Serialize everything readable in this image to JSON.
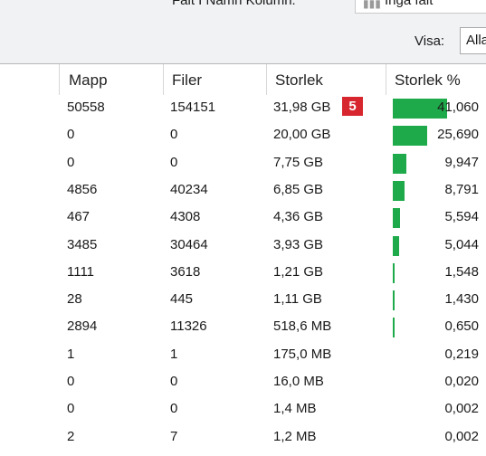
{
  "toolbar": {
    "filter_label": "Falt I  Namn  Kolumn:",
    "filter_value": "Inga falt",
    "visa_label": "Visa:",
    "visa_value": "Alla"
  },
  "badge": "5",
  "columns": {
    "mapp": "Mapp",
    "filer": "Filer",
    "size": "Storlek",
    "pct": "Storlek %"
  },
  "rows": [
    {
      "mapp": "50558",
      "filer": "154151",
      "size": "31,98 GB",
      "pct": "41,060",
      "value": 41.06
    },
    {
      "mapp": "0",
      "filer": "0",
      "size": "20,00 GB",
      "pct": "25,690",
      "value": 25.69
    },
    {
      "mapp": "0",
      "filer": "0",
      "size": "7,75 GB",
      "pct": "9,947",
      "value": 9.947
    },
    {
      "mapp": "4856",
      "filer": "40234",
      "size": "6,85 GB",
      "pct": "8,791",
      "value": 8.791
    },
    {
      "mapp": "467",
      "filer": "4308",
      "size": "4,36 GB",
      "pct": "5,594",
      "value": 5.594
    },
    {
      "mapp": "3485",
      "filer": "30464",
      "size": "3,93 GB",
      "pct": "5,044",
      "value": 5.044
    },
    {
      "mapp": "1111",
      "filer": "3618",
      "size": "1,21 GB",
      "pct": "1,548",
      "value": 1.548
    },
    {
      "mapp": "28",
      "filer": "445",
      "size": "1,11 GB",
      "pct": "1,430",
      "value": 1.43
    },
    {
      "mapp": "2894",
      "filer": "11326",
      "size": "518,6 MB",
      "pct": "0,650",
      "value": 0.65
    },
    {
      "mapp": "1",
      "filer": "1",
      "size": "175,0 MB",
      "pct": "0,219",
      "value": 0.219
    },
    {
      "mapp": "0",
      "filer": "0",
      "size": "16,0 MB",
      "pct": "0,020",
      "value": 0.02
    },
    {
      "mapp": "0",
      "filer": "0",
      "size": "1,4 MB",
      "pct": "0,002",
      "value": 0.002
    },
    {
      "mapp": "2",
      "filer": "7",
      "size": "1,2 MB",
      "pct": "0,002",
      "value": 0.002
    }
  ],
  "colors": {
    "bar": "#1eaa4a",
    "badge": "#d7262e"
  }
}
